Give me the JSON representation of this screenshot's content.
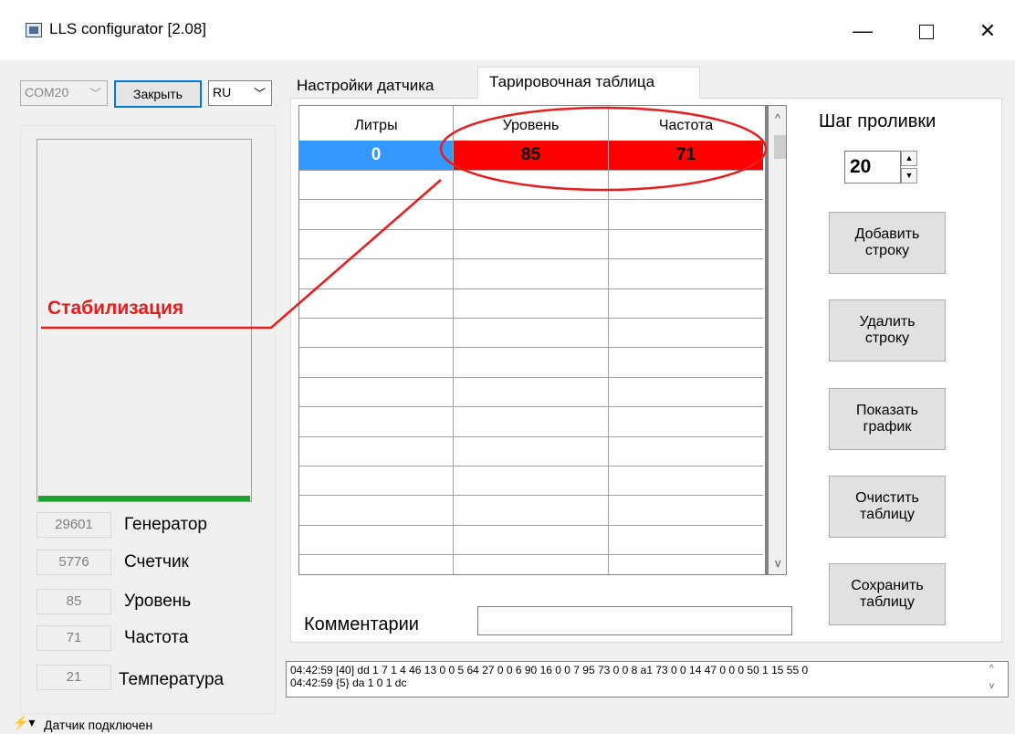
{
  "window": {
    "title": "LLS configurator [2.08]",
    "minimize": "—",
    "close": "✕"
  },
  "connection": {
    "port": "COM20",
    "close_button": "Закрыть",
    "language": "RU"
  },
  "stats": [
    {
      "value": "29601",
      "label": "Генератор"
    },
    {
      "value": "5776",
      "label": "Счетчик"
    },
    {
      "value": "85",
      "label": "Уровень"
    },
    {
      "value": "71",
      "label": "Частота"
    },
    {
      "value": "21",
      "label": "Температура"
    }
  ],
  "tabs": [
    {
      "label": "Настройки датчика",
      "active": false
    },
    {
      "label": "Тарировочная таблица",
      "active": true
    }
  ],
  "grid": {
    "columns": [
      "Литры",
      "Уровень",
      "Частота"
    ],
    "rows": [
      [
        "0",
        "85",
        "71"
      ]
    ],
    "selected_cell_color": "#3399ff",
    "highlight_color": "#ff0000"
  },
  "annotation": {
    "label": "Стабилизация",
    "color": "#e81c1c"
  },
  "calibration": {
    "step_label": "Шаг проливки",
    "step_value": "20",
    "buttons": {
      "add_row": [
        "Добавить",
        "строку"
      ],
      "delete_row": [
        "Удалить",
        "строку"
      ],
      "show_chart": [
        "Показать",
        "график"
      ],
      "clear_table": [
        "Очистить",
        "таблицу"
      ],
      "save_table": [
        "Сохранить",
        "таблицу"
      ]
    },
    "comments_label": "Комментарии",
    "comments_value": ""
  },
  "log": [
    "04:42:59 [40]  dd 1 7 1 4 46 13 0 0 5 64 27 0 0 6 90 16 0 0 7 95 73 0 0 8 a1 73 0 0 14 47 0 0 0 50 1 15 55 0",
    "04:42:59 {5}  da 1 0 1 dc"
  ],
  "status": {
    "text": "Датчик подключен"
  }
}
